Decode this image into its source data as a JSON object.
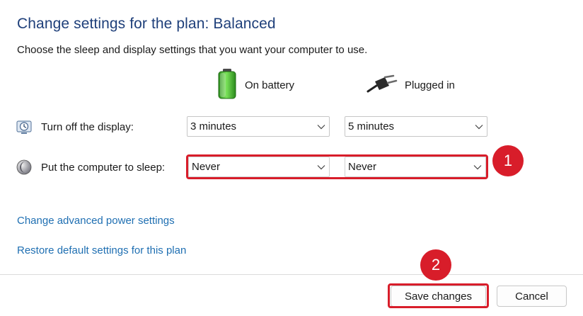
{
  "header": {
    "title": "Change settings for the plan: Balanced",
    "subtitle": "Choose the sleep and display settings that you want your computer to use."
  },
  "columns": {
    "battery": {
      "label": "On battery",
      "icon": "battery-icon"
    },
    "plugged": {
      "label": "Plugged in",
      "icon": "power-plug-icon"
    }
  },
  "rows": {
    "display": {
      "label": "Turn off the display:",
      "icon": "display-timer-icon",
      "battery_value": "3 minutes",
      "plugged_value": "5 minutes"
    },
    "sleep": {
      "label": "Put the computer to sleep:",
      "icon": "moon-sleep-icon",
      "battery_value": "Never",
      "plugged_value": "Never"
    }
  },
  "links": {
    "advanced": "Change advanced power settings",
    "restore": "Restore default settings for this plan"
  },
  "buttons": {
    "save": "Save changes",
    "cancel": "Cancel"
  },
  "annotations": {
    "step1": "1",
    "step2": "2"
  },
  "colors": {
    "title": "#1e3f7a",
    "link": "#1f6fb2",
    "annotation": "#d81d2a"
  }
}
